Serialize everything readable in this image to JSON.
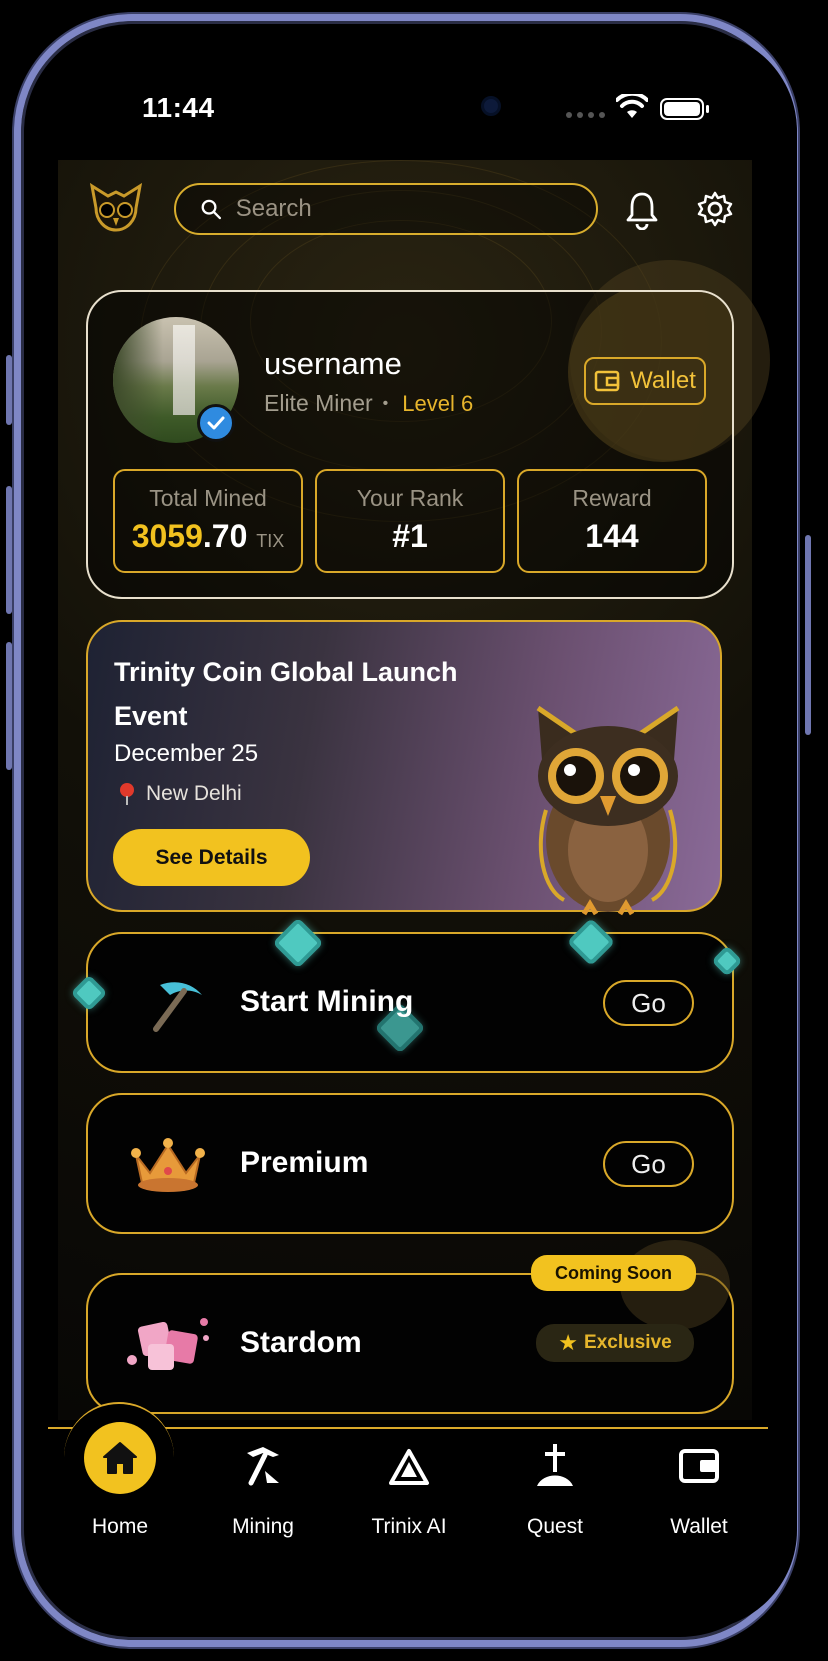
{
  "status_bar": {
    "time": "11:44"
  },
  "header": {
    "search_placeholder": "Search"
  },
  "profile": {
    "username": "username",
    "role": "Elite Miner",
    "separator": "•",
    "level": "Level 6",
    "wallet_label": "Wallet",
    "stats": {
      "total_mined": {
        "label": "Total Mined",
        "int": "3059",
        "dec": ".70",
        "unit": "TIX"
      },
      "rank": {
        "label": "Your Rank",
        "value": "#1"
      },
      "reward": {
        "label": "Reward",
        "value": "144"
      }
    }
  },
  "event": {
    "title_line1": "Trinity Coin Global Launch",
    "title_line2": "Event",
    "date": "December 25",
    "location": "New Delhi",
    "button": "See Details"
  },
  "actions": {
    "mining": {
      "title": "Start Mining",
      "button": "Go"
    },
    "premium": {
      "title": "Premium",
      "button": "Go"
    },
    "stardom": {
      "title": "Stardom",
      "badge": "Coming Soon",
      "tag": "Exclusive"
    }
  },
  "nav": [
    {
      "label": "Home",
      "icon": "home-icon",
      "active": true
    },
    {
      "label": "Mining",
      "icon": "pickaxe-icon",
      "active": false
    },
    {
      "label": "Trinix AI",
      "icon": "triangle-icon",
      "active": false
    },
    {
      "label": "Quest",
      "icon": "sword-icon",
      "active": false
    },
    {
      "label": "Wallet",
      "icon": "wallet-icon",
      "active": false
    }
  ],
  "colors": {
    "accent": "#f2c21f",
    "gold_border": "#d9a829",
    "background": "#000000",
    "frame": "#7f87c6"
  }
}
